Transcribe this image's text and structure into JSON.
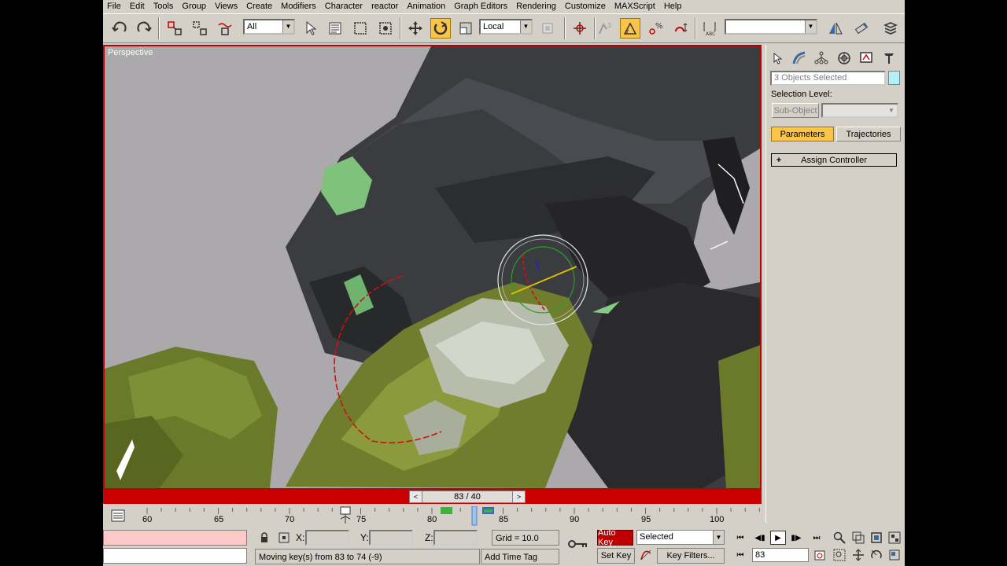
{
  "menu": [
    "File",
    "Edit",
    "Tools",
    "Group",
    "Views",
    "Create",
    "Modifiers",
    "Character",
    "reactor",
    "Animation",
    "Graph Editors",
    "Rendering",
    "Customize",
    "MAXScript",
    "Help"
  ],
  "toolbar": {
    "selection_filter": "All",
    "coordinate_system": "Local"
  },
  "viewport": {
    "label": "Perspective"
  },
  "time_slider": {
    "label": "83 / 40",
    "prev": "<",
    "next": ">"
  },
  "track": {
    "ticks": [
      "60",
      "65",
      "70",
      "75",
      "80",
      "85",
      "90",
      "95",
      "100"
    ]
  },
  "command_panel": {
    "selection_name": "3 Objects Selected",
    "selection_level_label": "Selection Level:",
    "sub_object_label": "Sub-Object",
    "parameters_label": "Parameters",
    "trajectories_label": "Trajectories",
    "rollout_sign": "+",
    "assign_controller_label": "Assign Controller"
  },
  "status": {
    "x_label": "X:",
    "y_label": "Y:",
    "z_label": "Z:",
    "grid": "Grid = 10.0",
    "prompt": "Moving key(s) from 83 to 74 (-9)",
    "add_time_tag": "Add Time Tag",
    "auto_key": "Auto Key",
    "set_key": "Set Key",
    "key_mode": "Selected",
    "key_filters": "Key Filters...",
    "current_frame": "83"
  },
  "colors": {
    "accent_active": "#f9c44a",
    "animation_red": "#c80000",
    "ui_gray": "#d4d0c8"
  }
}
